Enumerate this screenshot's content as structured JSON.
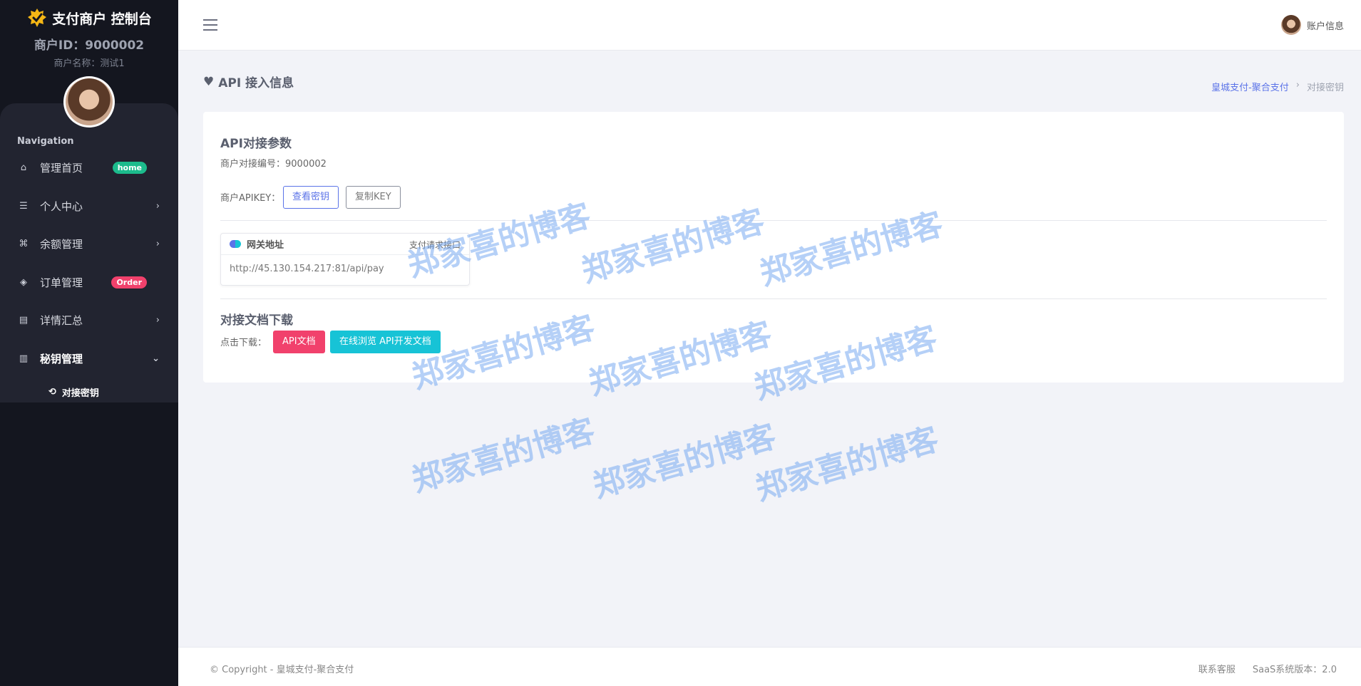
{
  "sidebar": {
    "brand_title": "支付商户 控制台",
    "merchant_id": "商户ID：9000002",
    "merchant_name": "商户名称：测试1",
    "nav_title": "Navigation",
    "items": [
      {
        "label": "管理首页",
        "icon": "home-icon",
        "badge": "home"
      },
      {
        "label": "个人中心",
        "icon": "list-icon",
        "chevron": "right"
      },
      {
        "label": "余额管理",
        "icon": "command-icon",
        "chevron": "right"
      },
      {
        "label": "订单管理",
        "icon": "layers-icon",
        "badge": "Order"
      },
      {
        "label": "详情汇总",
        "icon": "document-icon",
        "chevron": "right"
      },
      {
        "label": "秘钥管理",
        "icon": "map-icon",
        "chevron": "down"
      }
    ],
    "sub_items": [
      {
        "label": "对接密钥",
        "icon": "rotate-icon"
      }
    ]
  },
  "topbar": {
    "account_label": "账户信息"
  },
  "page": {
    "title": "API 接入信息",
    "breadcrumb": [
      "皇城支付-聚合支付",
      "对接密钥"
    ]
  },
  "card": {
    "api_section_title": "API对接参数",
    "merchant_no_label": "商户对接编号：9000002",
    "apikey_label": "商户APIKEY：",
    "view_key_button": "查看密钥",
    "copy_key_button": "复制KEY",
    "gateway_title": "网关地址",
    "gateway_subtitle": "支付请求接口",
    "gateway_url": "http://45.130.154.217:81/api/pay",
    "docs_section_title": "对接文档下载",
    "download_label": "点击下载：",
    "api_doc_button": "API文档",
    "online_doc_button": "在线浏览 API开发文档"
  },
  "watermark": "郑家喜的博客",
  "footer": {
    "copyright": "© Copyright - 皇城支付-聚合支付",
    "contact": "联系客服",
    "version": "SaaS系统版本：2.0"
  },
  "colors": {
    "sidebar_bg": "#14161f",
    "primary": "#5b73e8",
    "badge_green": "#1cbb8c",
    "badge_red": "#f1416c",
    "cyan": "#17c3d6"
  }
}
